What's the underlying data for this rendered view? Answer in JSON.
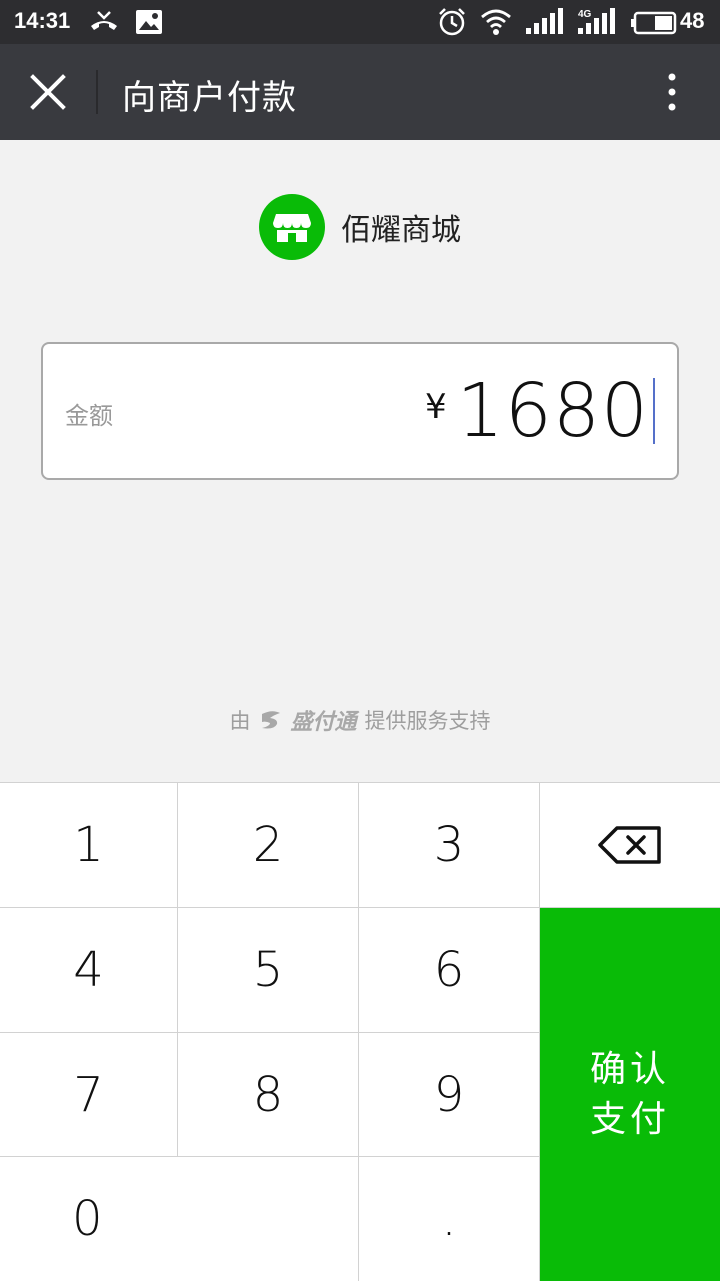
{
  "status_bar": {
    "time": "14:31",
    "battery": "48",
    "network": "4G"
  },
  "title_bar": {
    "title": "向商户付款"
  },
  "merchant": {
    "name": "佰耀商城",
    "icon": "store-icon",
    "icon_color": "#09bb07"
  },
  "amount": {
    "label": "金额",
    "currency": "¥",
    "value": "1680"
  },
  "provider": {
    "prefix": "由",
    "brand": "盛付通",
    "suffix": "提供服务支持"
  },
  "keypad": {
    "keys": [
      "1",
      "2",
      "3",
      "4",
      "5",
      "6",
      "7",
      "8",
      "9",
      "0",
      "."
    ],
    "backspace_icon": "backspace-icon",
    "confirm_label": "确认支付",
    "confirm_color": "#09bb07"
  }
}
